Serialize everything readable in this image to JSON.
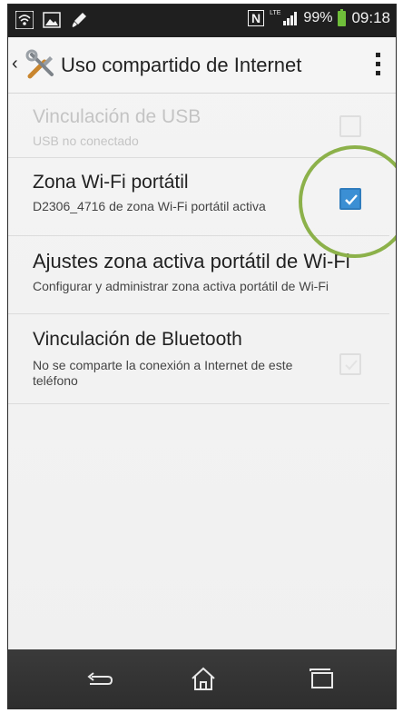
{
  "status_bar": {
    "icons_left": [
      "wifi-icon",
      "image-icon",
      "paint-icon"
    ],
    "nfc": "N",
    "network": "LTE",
    "battery_percent": "99%",
    "time": "09:18"
  },
  "action_bar": {
    "title": "Uso compartido de Internet"
  },
  "items": [
    {
      "title": "Vinculación de USB",
      "summary": "USB no conectado",
      "checked": false,
      "enabled": false
    },
    {
      "title": "Zona Wi-Fi portátil",
      "summary": "D2306_4716 de zona Wi-Fi portátil activa",
      "checked": true,
      "enabled": true
    },
    {
      "title": "Ajustes zona activa portátil de Wi-Fi",
      "summary": "Configurar y administrar zona activa portátil de Wi-Fi",
      "enabled": true
    },
    {
      "title": "Vinculación de Bluetooth",
      "summary": "No se comparte la conexión a Internet de este teléfono",
      "checked": false,
      "enabled": true
    }
  ],
  "nav": [
    "back-icon",
    "home-icon",
    "recents-icon"
  ],
  "colors": {
    "accent": "#3b8fd4",
    "highlight": "#8cb14a",
    "status_bar": "#1f1f1f",
    "nav_bar": "#333333"
  }
}
